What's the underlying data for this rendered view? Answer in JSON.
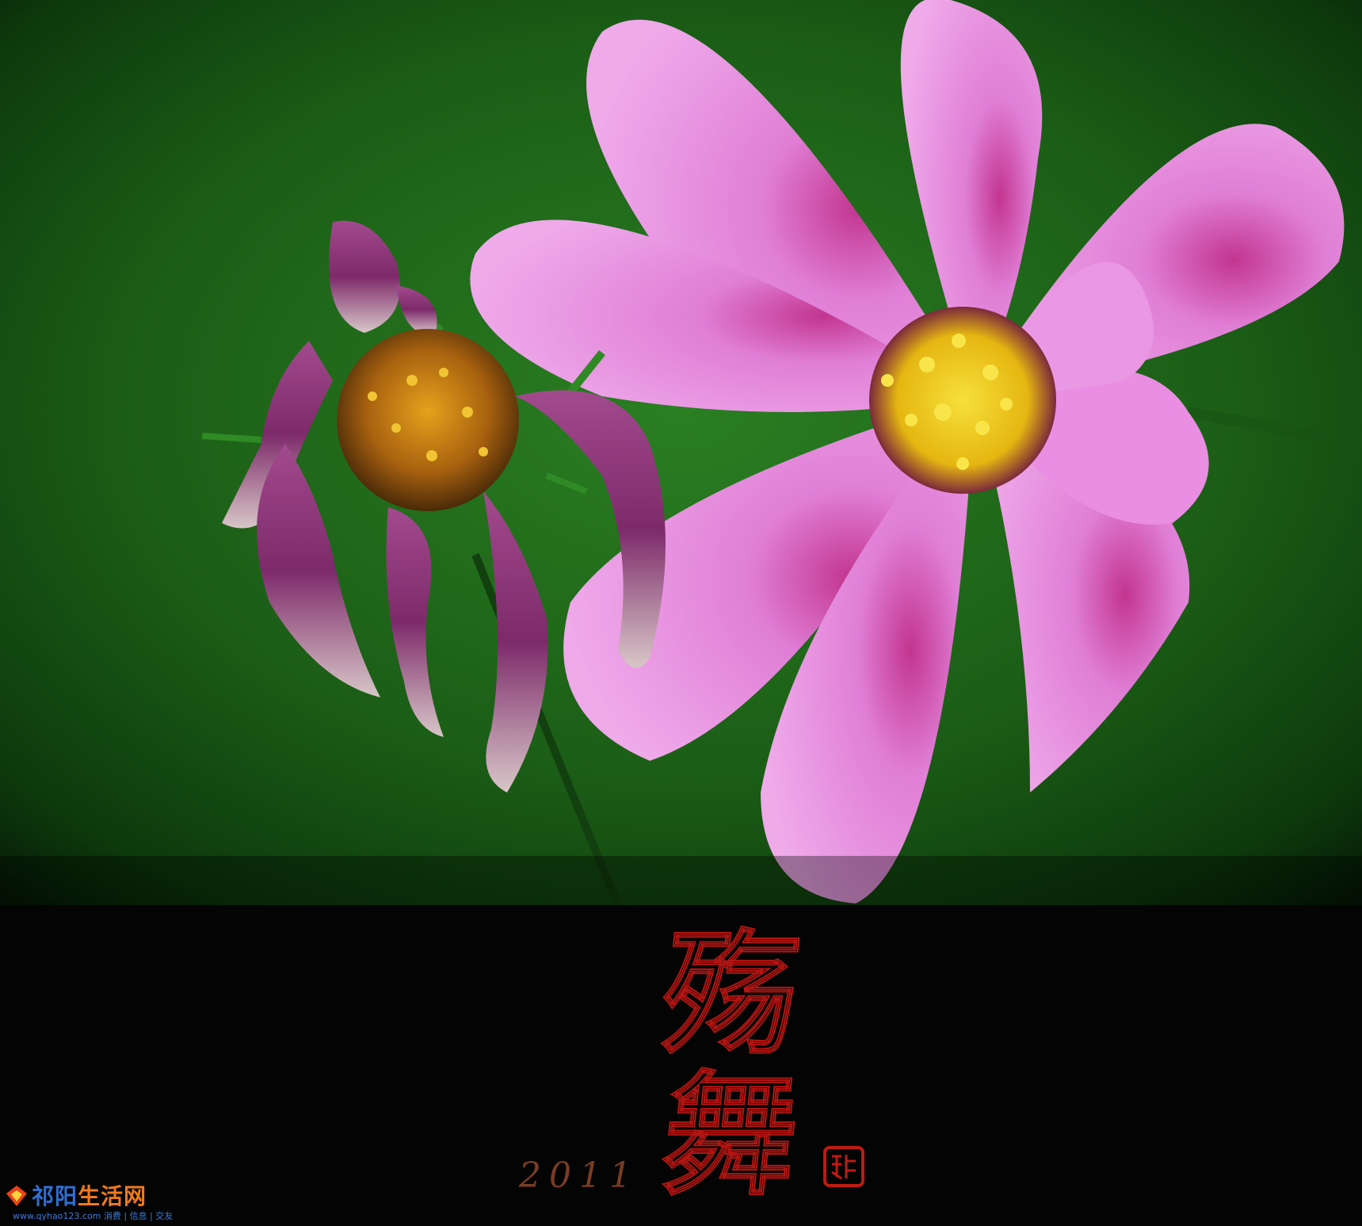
{
  "image": {
    "description_colors": {
      "background_green": "#1f6a1a",
      "flower_pink": "#e58fe3",
      "flower_center": "#f2d11b",
      "wilted_petal": "#9b3f85",
      "band_black": "#040404",
      "title_red": "#b41512",
      "year_brown": "#7a3c24"
    }
  },
  "poster": {
    "title_char_1": "殇",
    "title_char_2": "舞",
    "year": "2011",
    "seal_text": "居士印"
  },
  "watermark": {
    "site_name_main": "祁阳",
    "site_name_accent": "生活网",
    "site_url": "www.qyhao123.com 消费 | 信息 | 交友"
  }
}
